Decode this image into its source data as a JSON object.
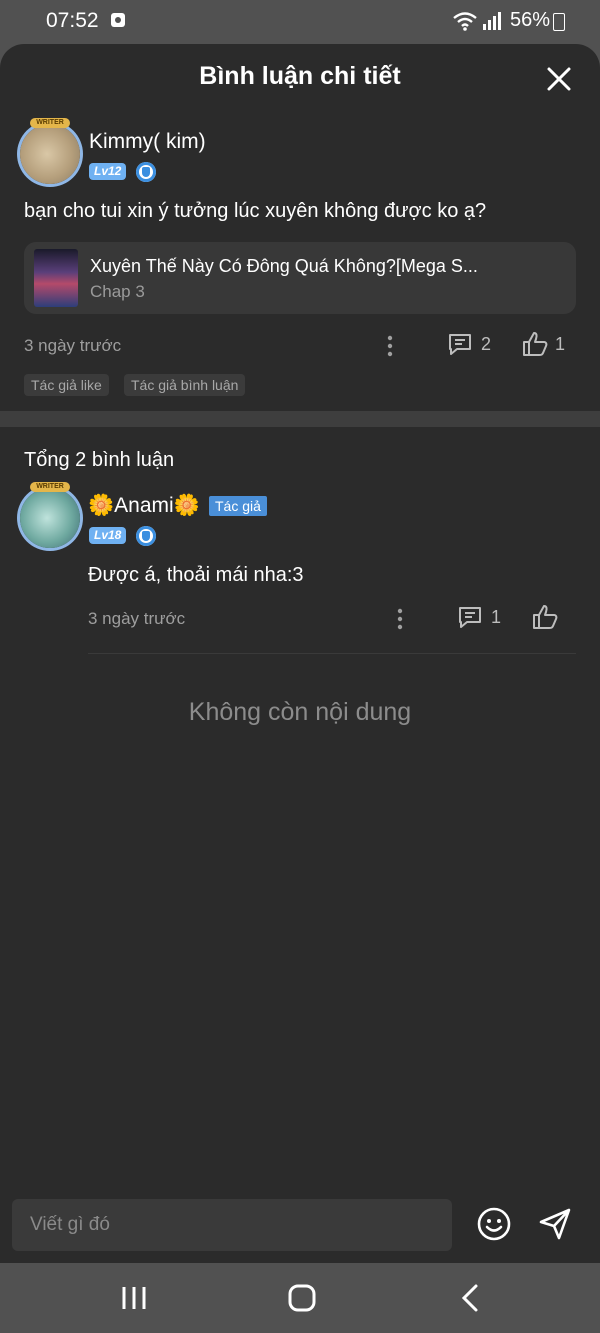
{
  "status_bar": {
    "time": "07:52",
    "battery": "56%",
    "icons": [
      "app-notification-icon",
      "wifi-icon",
      "signal-icon",
      "battery-icon"
    ]
  },
  "header": {
    "title": "Bình luận chi tiết",
    "close_icon": "close-icon"
  },
  "main_comment": {
    "username": "Kimmy( kim)",
    "level": "Lv12",
    "avatar_badge": "WRITER",
    "text": "bạn cho tui xin ý tưởng lúc xuyên không được ko ạ?",
    "chapter_card": {
      "title": "Xuyên Thế Này Có Đông Quá Không?[Mega S...",
      "subtitle": "Chap 3"
    },
    "time": "3 ngày trước",
    "reply_count": "2",
    "like_count": "1",
    "tags": [
      "Tác giả like",
      "Tác giả bình luận"
    ]
  },
  "replies_section": {
    "title": "Tổng 2 bình luận",
    "replies": [
      {
        "username": "🌼Anami🌼",
        "author_tag": "Tác giả",
        "level": "Lv18",
        "avatar_badge": "WRITER",
        "text": "Được á, thoải mái nha:3",
        "time": "3 ngày trước",
        "reply_count": "1"
      }
    ],
    "end_message": "Không còn nội dung"
  },
  "composer": {
    "placeholder": "Viết gì đó"
  },
  "nav_bar": {
    "buttons": [
      "recent-apps-icon",
      "home-icon",
      "back-icon"
    ]
  },
  "colors": {
    "sheet_background": "#2b2b2b",
    "level_badge": "#6fb1f2",
    "author_tag": "#4a8fd8"
  }
}
